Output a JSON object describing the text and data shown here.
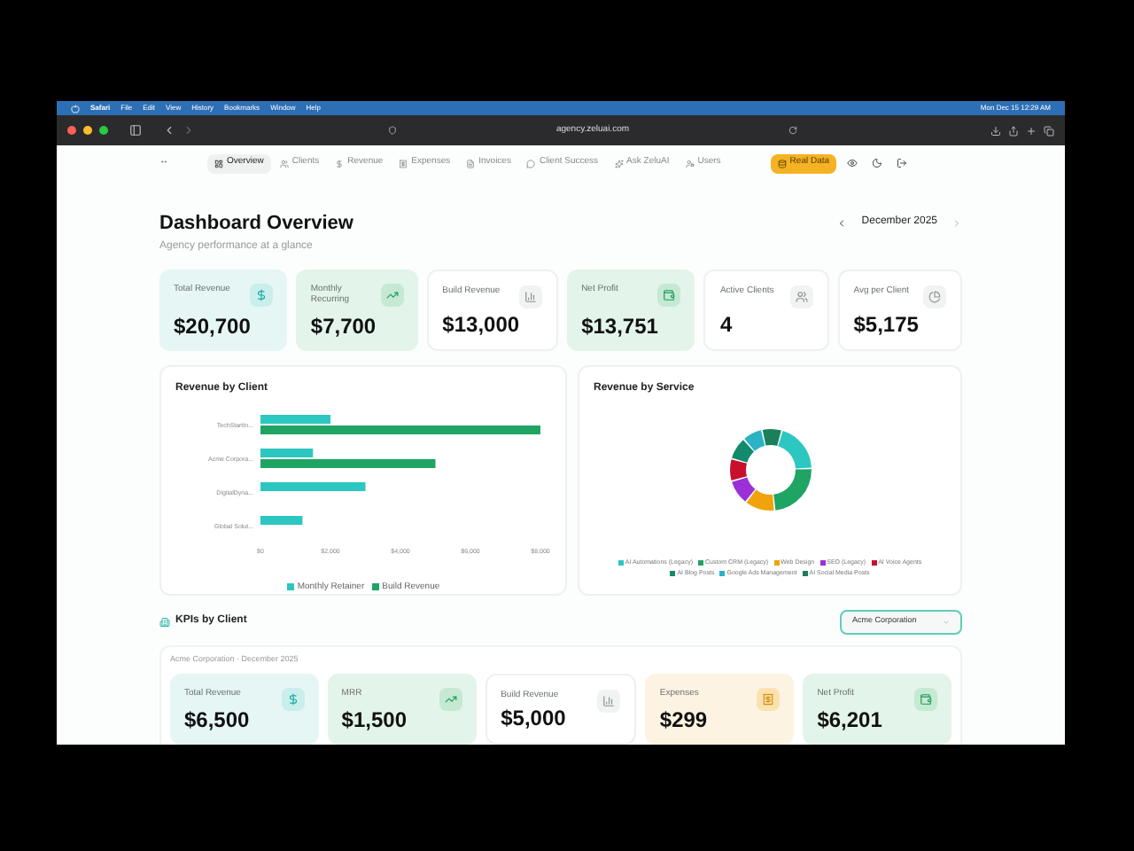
{
  "menubar": {
    "items": [
      "Safari",
      "File",
      "Edit",
      "View",
      "History",
      "Bookmarks",
      "Window",
      "Help"
    ],
    "clock": "Mon Dec 15  12:29 AM"
  },
  "browser": {
    "url": "agency.zeluai.com"
  },
  "nav": {
    "collapse": "↔",
    "tabs": [
      {
        "label": "Overview",
        "selected": true
      },
      {
        "label": "Clients",
        "selected": false
      },
      {
        "label": "Revenue",
        "selected": false
      },
      {
        "label": "Expenses",
        "selected": false
      },
      {
        "label": "Invoices",
        "selected": false
      },
      {
        "label": "Client Success",
        "selected": false
      },
      {
        "label": "Ask ZeluAI",
        "selected": false
      },
      {
        "label": "Users",
        "selected": false
      }
    ],
    "data_button": "Real Data"
  },
  "header": {
    "title": "Dashboard Overview",
    "subtitle": "Agency performance at a glance",
    "period": "December 2025"
  },
  "kpis": [
    {
      "label": "Total Revenue",
      "value": "$20,700",
      "kind": "teal"
    },
    {
      "label": "Monthly Recurring",
      "value": "$7,700",
      "kind": "green"
    },
    {
      "label": "Build Revenue",
      "value": "$13,000",
      "kind": "plain"
    },
    {
      "label": "Net Profit",
      "value": "$13,751",
      "kind": "green"
    },
    {
      "label": "Active Clients",
      "value": "4",
      "kind": "plain"
    },
    {
      "label": "Avg per Client",
      "value": "$5,175",
      "kind": "plain"
    }
  ],
  "revenue_by_client": {
    "title": "Revenue by Client",
    "chart_data": {
      "type": "bar",
      "orientation": "horizontal",
      "categories": [
        "TechStartIn...",
        "Acme Corpora...",
        "DigitalDyna...",
        "Global Solut..."
      ],
      "series": [
        {
          "name": "Monthly Retainer",
          "color": "#2cc7c0",
          "values": [
            2000,
            1500,
            3000,
            1200
          ]
        },
        {
          "name": "Build Revenue",
          "color": "#1fa463",
          "values": [
            8000,
            5000,
            null,
            null
          ]
        }
      ],
      "xlim": [
        0,
        8000
      ],
      "xticks": [
        {
          "value": 0,
          "label": "$0"
        },
        {
          "value": 2000,
          "label": "$2,000"
        },
        {
          "value": 4000,
          "label": "$4,000"
        },
        {
          "value": 6000,
          "label": "$6,000"
        },
        {
          "value": 8000,
          "label": "$8,000"
        }
      ]
    }
  },
  "revenue_by_service": {
    "title": "Revenue by Service",
    "legend": [
      {
        "label": "AI Automations (Legacy)",
        "color": "#2cc7c0"
      },
      {
        "label": "Custom CRM (Legacy)",
        "color": "#1fa463"
      },
      {
        "label": "Web Design",
        "color": "#f0a30a"
      },
      {
        "label": "SEO (Legacy)",
        "color": "#9b30d9"
      },
      {
        "label": "AI Voice Agents",
        "color": "#c8102e"
      },
      {
        "label": "AI Blog Posts",
        "color": "#138a6b"
      },
      {
        "label": "Google Ads Management",
        "color": "#2ab3c4"
      },
      {
        "label": "AI Social Media Posts",
        "color": "#1b7f5a"
      }
    ]
  },
  "client_kpis": {
    "title": "KPIs by Client",
    "client_select": "Acme Corporation",
    "caption": "Acme Corporation · December 2025",
    "cards": [
      {
        "label": "Total Revenue",
        "value": "$6,500",
        "kind": "teal"
      },
      {
        "label": "MRR",
        "value": "$1,500",
        "kind": "green"
      },
      {
        "label": "Build Revenue",
        "value": "$5,000",
        "kind": "plain"
      },
      {
        "label": "Expenses",
        "value": "$299",
        "kind": "amber"
      },
      {
        "label": "Net Profit",
        "value": "$6,201",
        "kind": "green"
      }
    ]
  }
}
